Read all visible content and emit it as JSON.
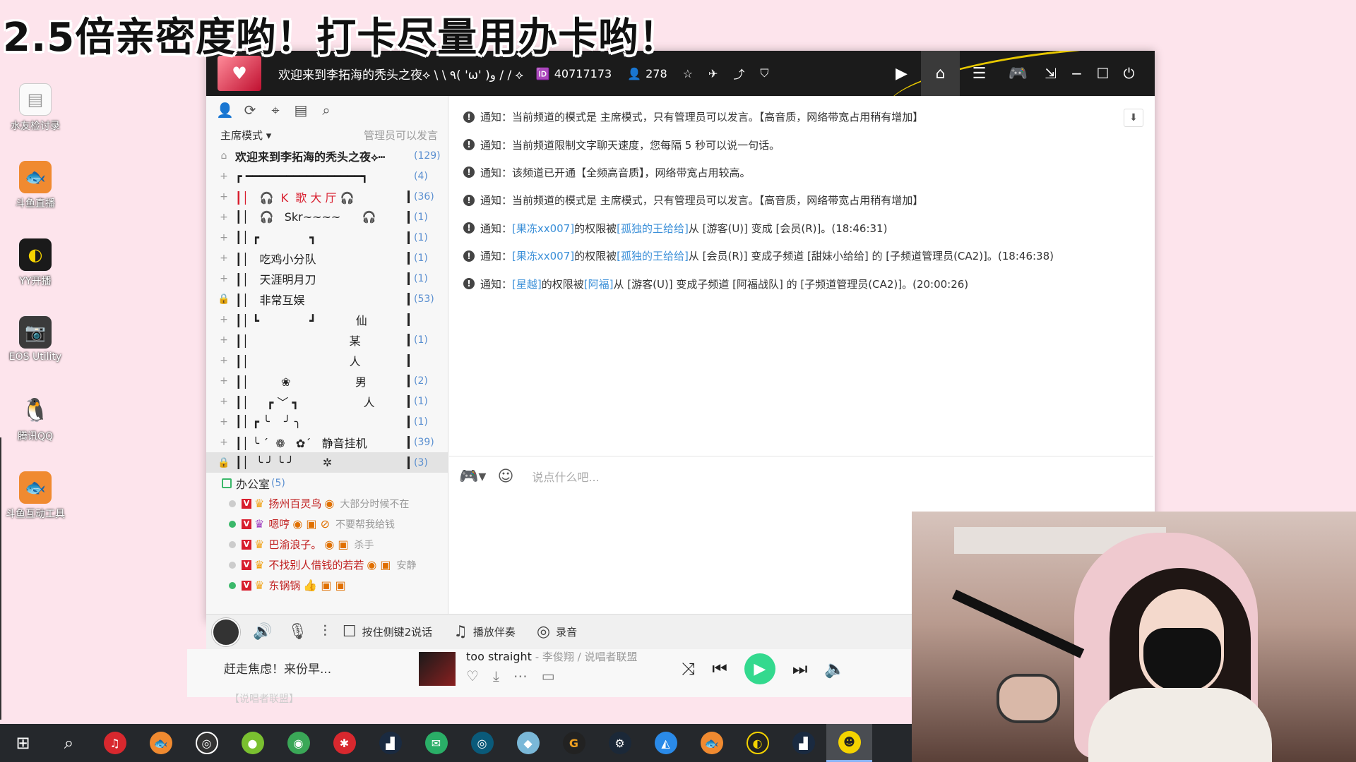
{
  "overlay": {
    "title": "2.5倍亲密度哟！打卡尽量用办卡哟！"
  },
  "desktop": {
    "icons": [
      {
        "label": "水友检讨录",
        "name": "doc",
        "color": "#f0f0f0"
      },
      {
        "label": "斗鱼直播",
        "name": "douyu",
        "color": "#f08a30"
      },
      {
        "label": "YY开播",
        "name": "yy",
        "color": "#222222"
      },
      {
        "label": "EOS Utility",
        "name": "camera",
        "color": "#3b3b3b"
      },
      {
        "label": "腾讯QQ",
        "name": "qq",
        "color": "#111111"
      },
      {
        "label": "斗鱼互动工具",
        "name": "douyu-tool",
        "color": "#f08a30"
      }
    ]
  },
  "yy": {
    "channel_name": "欢迎来到李拓海的秃头之夜⟡ \\ \\ ٩( 'ω' )و / / ⟡",
    "channel_id": "40717173",
    "online_count": "278",
    "mode_label": "主席模式",
    "mode_note": "管理员可以发言",
    "channels": [
      {
        "name": "欢迎来到李拓海的秃头之夜⟡┅",
        "count": "(129)",
        "root": true
      },
      {
        "name": "┏ ━━━━━━━━━━━━━━━━━┓",
        "count": "(4)"
      },
      {
        "name": "┃│   🎧  K  歌 大 厅 🎧",
        "count": "(36)",
        "red": true
      },
      {
        "name": "┃│   🎧   Skr~~~~      🎧",
        "count": "(1)"
      },
      {
        "name": "┃│ ┏              ┓",
        "count": "(1)"
      },
      {
        "name": "┃│   吃鸡小分队",
        "count": "(1)"
      },
      {
        "name": "┃│   天涯明月刀",
        "count": "(1)"
      },
      {
        "name": "┃│   非常互娱",
        "count": "(53)"
      },
      {
        "name": "┃│ ┗              ┛           仙",
        "count": ""
      },
      {
        "name": "┃│                            某",
        "count": "(1)"
      },
      {
        "name": "┃│                            人",
        "count": ""
      },
      {
        "name": "┃│         ❀                  男",
        "count": "(2)"
      },
      {
        "name": "┃│     ┏ ﹀ ┓                  人",
        "count": "(1)"
      },
      {
        "name": "┃│ ┏ ╰    ╯ ╮",
        "count": "(1)"
      },
      {
        "name": "┃│ ╰ ˊ  ❁   ✿ˊ   静音挂机",
        "count": "(39)"
      },
      {
        "name": "┃│  ╰ ╯ ╰ ╯        ✲",
        "count": "(3)",
        "selected": true
      }
    ],
    "office": {
      "label": "办公室",
      "count": "(5)"
    },
    "members": [
      {
        "name": "扬州百灵鸟",
        "note": "大部分时候不在",
        "online": false
      },
      {
        "name": "嗯哼",
        "note": "不要帮我给钱",
        "online": true
      },
      {
        "name": "巴渝浪子。",
        "note": "杀手",
        "online": false
      },
      {
        "name": "不找别人借钱的若若",
        "note": "安静",
        "online": false
      },
      {
        "name": "东锅锅",
        "note": "",
        "online": true
      }
    ],
    "messages": [
      {
        "pre": "通知：当前频道的模式是 主席模式，只有管理员可以发言。【高音质，网络带宽占用稍有增加】",
        "segs": []
      },
      {
        "pre": "通知：当前频道限制文字聊天速度，您每隔 5 秒可以说一句话。",
        "segs": []
      },
      {
        "pre": "通知：该频道已开通【全频高音质】，网络带宽占用较高。",
        "segs": []
      },
      {
        "pre": "通知：当前频道的模式是 主席模式，只有管理员可以发言。【高音质，网络带宽占用稍有增加】",
        "segs": []
      },
      {
        "pre": "通知：",
        "link1": "[果冻xx007]",
        "mid": " 的权限被 ",
        "link2": "[孤独的王给给]",
        "post": " 从 [游客(U)] 变成 [会员(R)]。(18:46:31)"
      },
      {
        "pre": "通知：",
        "link1": "[果冻xx007]",
        "mid": " 的权限被 ",
        "link2": "[孤独的王给给]",
        "post": " 从 [会员(R)] 变成子频道 [甜妹小给给] 的 [子频道管理员(CA2)]。(18:46:38)"
      },
      {
        "pre": "通知：",
        "link1": "[星越]",
        "mid": " 的权限被 ",
        "link2": "[阿福]",
        "post": " 从 [游客(U)] 变成子频道 [阿福战队] 的 [子频道管理员(CA2)]。(20:00:26)"
      }
    ],
    "input_placeholder": "说点什么吧...",
    "toolbar": {
      "push_to_talk": "按住侧键2说话",
      "accompany": "播放伴奏",
      "record": "录音"
    }
  },
  "player": {
    "lyric": "赶走焦虑！来份早...",
    "song": "too straight",
    "artist": " - 李俊翔 / 说唱者联盟",
    "ghost_text": "【说唱者联盟】"
  }
}
